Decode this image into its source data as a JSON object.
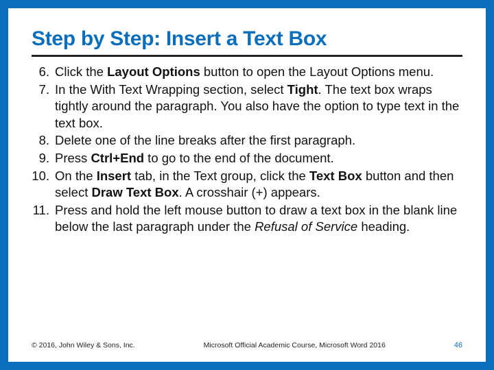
{
  "title": "Step by Step: Insert a Text Box",
  "steps": [
    {
      "num": "6.",
      "pre": "Click the ",
      "b1": "Layout Options",
      "post": " button to open the Layout Options menu."
    },
    {
      "num": "7.",
      "pre": "In the With Text Wrapping section, select ",
      "b1": "Tight",
      "post": ". The text box wraps tightly around the paragraph. You also have the option to type text in the text box."
    },
    {
      "num": "8.",
      "pre": "Delete one of the line breaks after the first paragraph.",
      "b1": "",
      "post": ""
    },
    {
      "num": "9.",
      "pre": "Press ",
      "b1": "Ctrl+End",
      "post": " to go to the end of the document."
    },
    {
      "num": "10.",
      "pre": "On the ",
      "b1": "Insert",
      "mid1": " tab, in the Text group, click the ",
      "b2": "Text Box",
      "mid2": " button and then select ",
      "b3": "Draw Text Box",
      "post": ". A crosshair (+) appears."
    },
    {
      "num": "11.",
      "pre": "Press and hold the left mouse button to draw a text box in the blank line below the last paragraph under the ",
      "i1": "Refusal of Service",
      "post": " heading."
    }
  ],
  "footer": {
    "copyright": "© 2016, John Wiley & Sons, Inc.",
    "course": "Microsoft Official Academic Course, Microsoft Word 2016",
    "page": "46"
  }
}
